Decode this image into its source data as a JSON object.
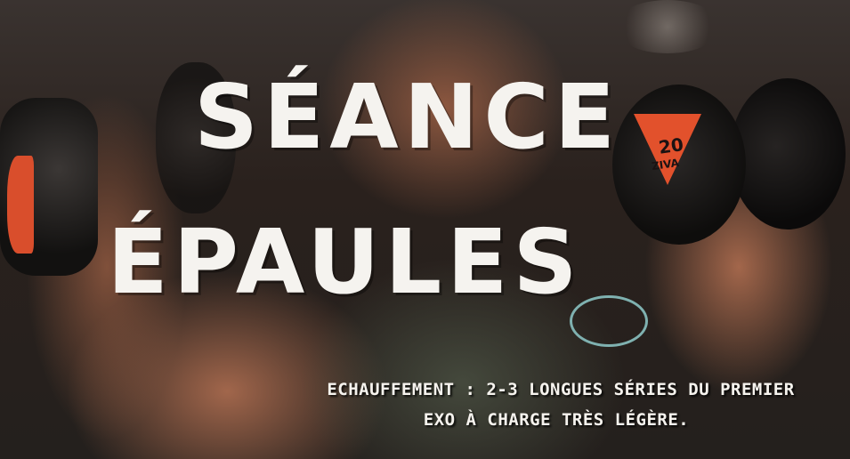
{
  "photo": {
    "plate_number": "20",
    "plate_brand": "ZIVA",
    "accent_color": "#e2512c"
  },
  "title": {
    "line1": "SÉANCE",
    "line2": "ÉPAULES"
  },
  "caption": {
    "line1": "ECHAUFFEMENT : 2-3 LONGUES SÉRIES DU PREMIER",
    "line2": "EXO À CHARGE TRÈS LÉGÈRE."
  }
}
